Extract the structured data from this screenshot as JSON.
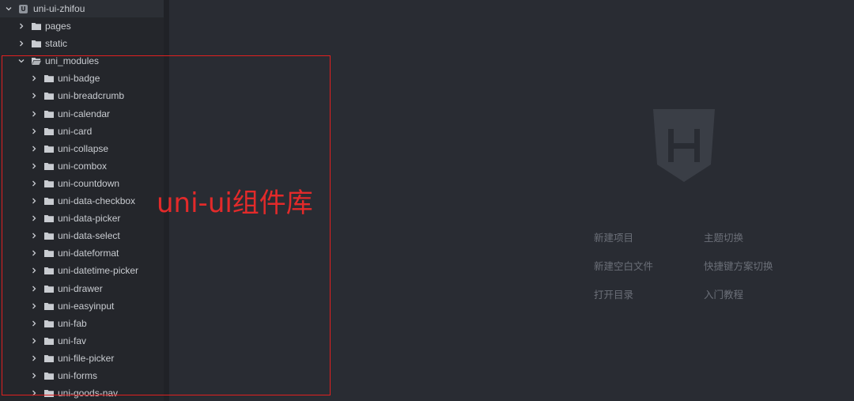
{
  "project": {
    "name": "uni-ui-zhifou",
    "icon": "project-icon"
  },
  "tree": [
    {
      "label": "pages",
      "level": 1,
      "expanded": false
    },
    {
      "label": "static",
      "level": 1,
      "expanded": false
    },
    {
      "label": "uni_modules",
      "level": 1,
      "expanded": true
    },
    {
      "label": "uni-badge",
      "level": 2,
      "expanded": false
    },
    {
      "label": "uni-breadcrumb",
      "level": 2,
      "expanded": false
    },
    {
      "label": "uni-calendar",
      "level": 2,
      "expanded": false
    },
    {
      "label": "uni-card",
      "level": 2,
      "expanded": false
    },
    {
      "label": "uni-collapse",
      "level": 2,
      "expanded": false
    },
    {
      "label": "uni-combox",
      "level": 2,
      "expanded": false
    },
    {
      "label": "uni-countdown",
      "level": 2,
      "expanded": false
    },
    {
      "label": "uni-data-checkbox",
      "level": 2,
      "expanded": false
    },
    {
      "label": "uni-data-picker",
      "level": 2,
      "expanded": false
    },
    {
      "label": "uni-data-select",
      "level": 2,
      "expanded": false
    },
    {
      "label": "uni-dateformat",
      "level": 2,
      "expanded": false
    },
    {
      "label": "uni-datetime-picker",
      "level": 2,
      "expanded": false
    },
    {
      "label": "uni-drawer",
      "level": 2,
      "expanded": false
    },
    {
      "label": "uni-easyinput",
      "level": 2,
      "expanded": false
    },
    {
      "label": "uni-fab",
      "level": 2,
      "expanded": false
    },
    {
      "label": "uni-fav",
      "level": 2,
      "expanded": false
    },
    {
      "label": "uni-file-picker",
      "level": 2,
      "expanded": false
    },
    {
      "label": "uni-forms",
      "level": 2,
      "expanded": false
    },
    {
      "label": "uni-goods-nav",
      "level": 2,
      "expanded": false
    }
  ],
  "annotation": {
    "label": "uni-ui组件库",
    "color": "#e02020"
  },
  "welcome": {
    "logo_icon": "hbuilder-logo-icon",
    "links": {
      "new_project": "新建项目",
      "theme_switch": "主题切换",
      "new_blank_file": "新建空白文件",
      "shortcut_scheme": "快捷键方案切换",
      "open_directory": "打开目录",
      "tutorial": "入门教程"
    }
  },
  "colors": {
    "editor_bg": "#292c33",
    "sidebar_bg": "#24262b",
    "text": "#c9ccd1",
    "muted": "#6b6f78"
  }
}
